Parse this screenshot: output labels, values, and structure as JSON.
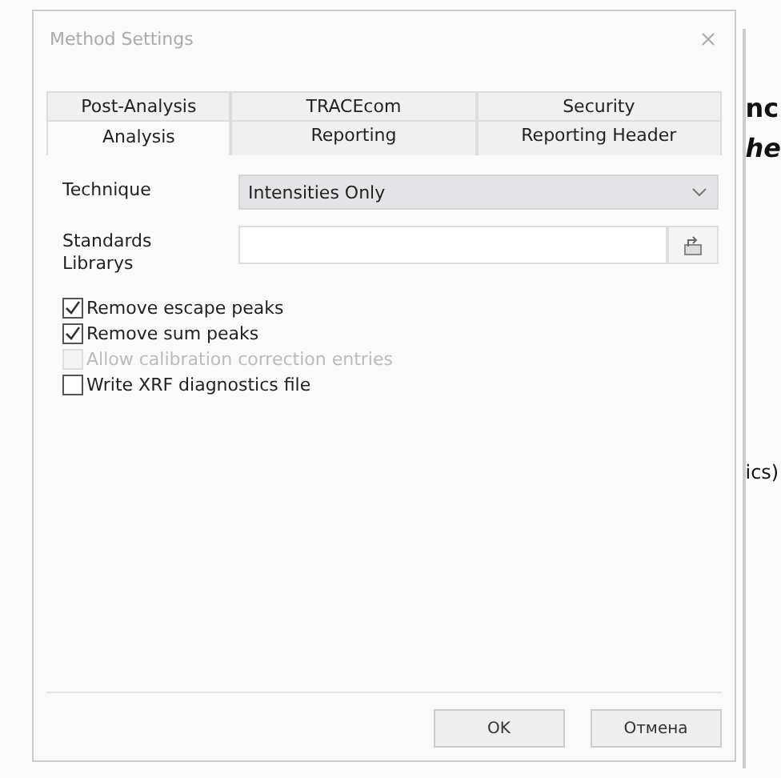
{
  "window": {
    "title": "Method Settings"
  },
  "tabs": [
    [
      {
        "label": "Post-Analysis",
        "selected": false
      },
      {
        "label": "TRACEcom",
        "selected": false
      },
      {
        "label": "Security",
        "selected": false
      }
    ],
    [
      {
        "label": "Analysis",
        "selected": true
      },
      {
        "label": "Reporting",
        "selected": false
      },
      {
        "label": "Reporting Header",
        "selected": false
      }
    ]
  ],
  "fields": [
    {
      "kind": "dropdown",
      "label": "Technique",
      "value": "Intensities Only"
    },
    {
      "kind": "browse",
      "label": "Standards Librarys"
    }
  ],
  "options": [
    {
      "label": "Remove escape peaks",
      "checked": true,
      "disabled": false
    },
    {
      "label": "Remove sum peaks",
      "checked": true,
      "disabled": false
    },
    {
      "label": "Allow calibration correction entries",
      "checked": false,
      "disabled": true
    },
    {
      "label": "Write XRF diagnostics file",
      "checked": false,
      "disabled": false
    }
  ],
  "buttons": [
    "OK",
    "Отмена"
  ],
  "background_text": [
    "nc",
    "he",
    "ics)"
  ]
}
